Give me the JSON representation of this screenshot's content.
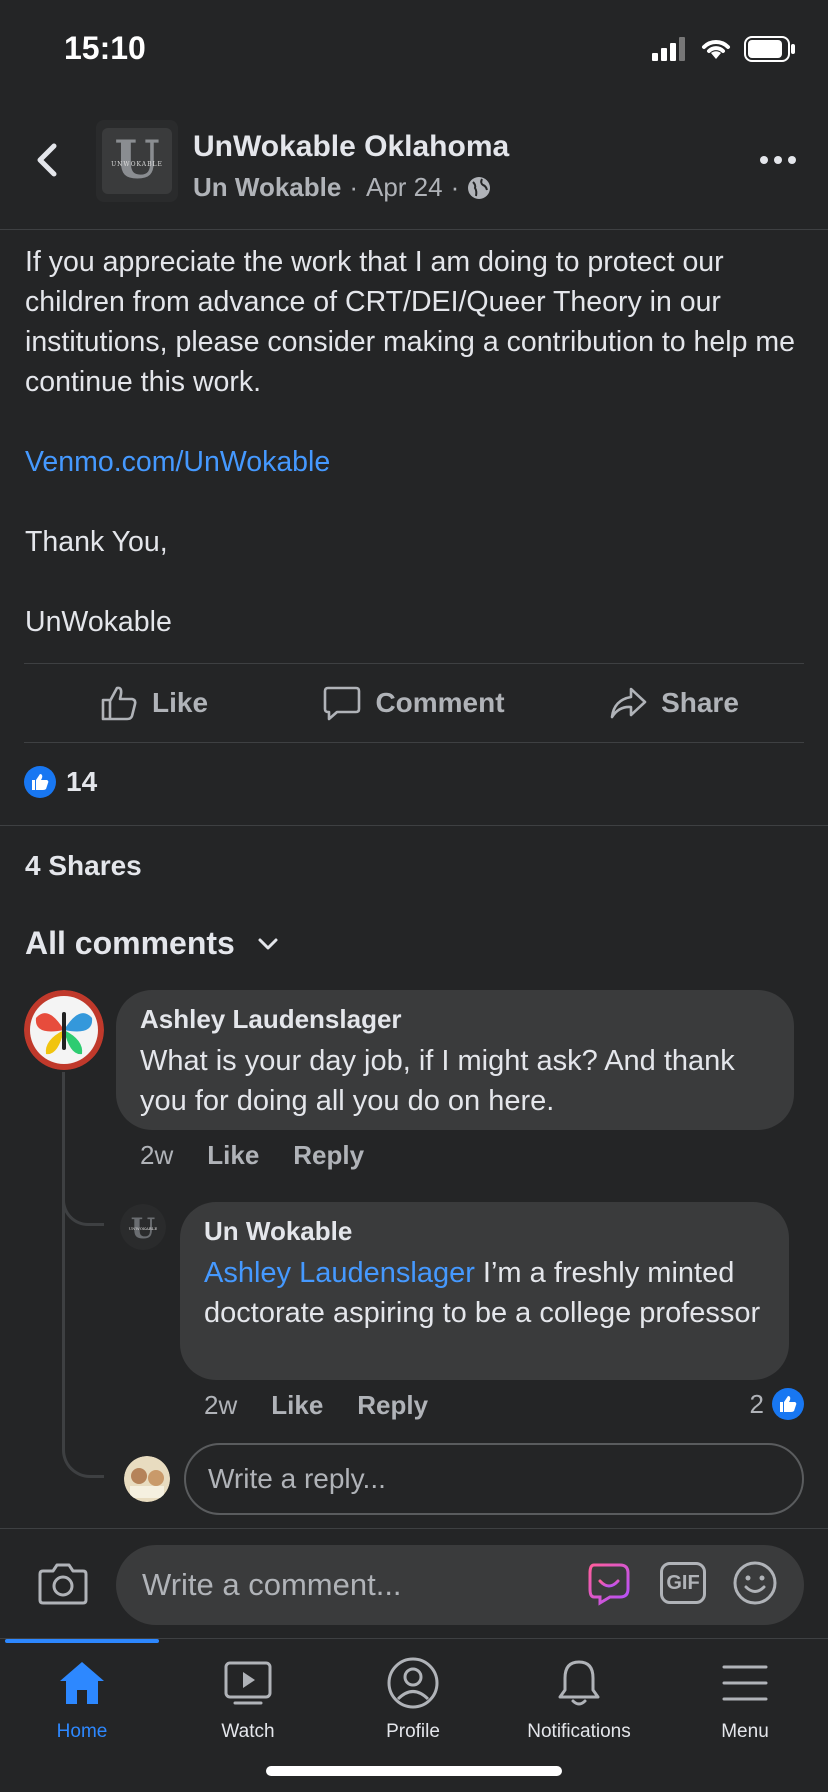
{
  "status_bar": {
    "time": "15:10"
  },
  "post": {
    "page_name": "UnWokable Oklahoma",
    "author": "Un Wokable",
    "date": "Apr 24",
    "separator": "·",
    "avatar_text": "UNWOKABLE",
    "body": [
      "If you appreciate the work that I am doing to protect our children from advance of CRT/DEI/Queer Theory in our institutions, please consider making a contribution to help me continue this work."
    ],
    "link": "Venmo.com/UnWokable",
    "closing": "Thank You,",
    "signature": "UnWokable"
  },
  "actions": {
    "like": "Like",
    "comment": "Comment",
    "share": "Share"
  },
  "reactions": {
    "count": "14"
  },
  "shares": "4 Shares",
  "comments_filter": "All comments",
  "comments": [
    {
      "author": "Ashley Laudenslager",
      "text": "What is your day job, if I might ask? And thank you for doing all you do on here.",
      "time": "2w",
      "like": "Like",
      "reply": "Reply"
    }
  ],
  "reply": {
    "author": "Un Wokable",
    "mention": "Ashley Laudenslager",
    "text": " I’m a freshly minted doctorate aspiring to be a college professor",
    "time": "2w",
    "like": "Like",
    "reply": "Reply",
    "like_count": "2"
  },
  "reply_input": {
    "placeholder": "Write a reply..."
  },
  "composer": {
    "placeholder": "Write a comment...",
    "gif": "GIF"
  },
  "tabs": [
    {
      "label": "Home",
      "icon": "home-icon",
      "active": true
    },
    {
      "label": "Watch",
      "icon": "watch-icon"
    },
    {
      "label": "Profile",
      "icon": "profile-icon"
    },
    {
      "label": "Notifications",
      "icon": "bell-icon"
    },
    {
      "label": "Menu",
      "icon": "menu-icon"
    }
  ],
  "colors": {
    "accent": "#2d88ff",
    "link": "#4599ff",
    "background": "#242526",
    "bubble": "#3a3b3c"
  }
}
